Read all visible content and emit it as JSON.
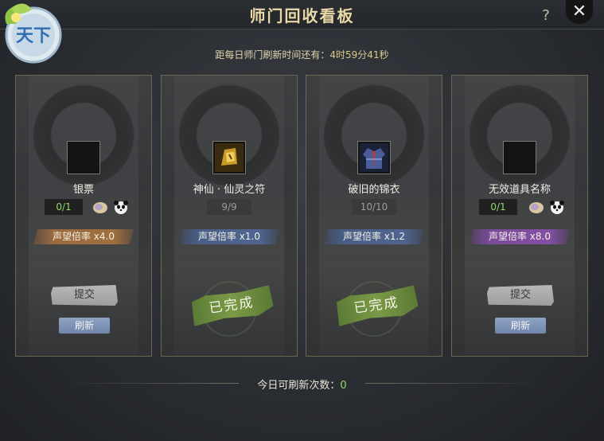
{
  "window": {
    "title": "师门回收看板",
    "help_label": "?",
    "close_label": "✕",
    "logo_text": "天下"
  },
  "timer": {
    "label": "距每日师门刷新时间还有：",
    "value": "4时59分41秒"
  },
  "cards": [
    {
      "item_name": "银票",
      "quantity": "0/1",
      "multiplier": "声望倍率 x4.0",
      "multiplier_color": "brown",
      "submit_label": "提交",
      "refresh_label": "刷新",
      "completed": false,
      "icons": [
        "shell-icon",
        "panda-icon"
      ]
    },
    {
      "item_name": "神仙 · 仙灵之符",
      "quantity": "9/9",
      "multiplier": "声望倍率 x1.0",
      "multiplier_color": "blue",
      "completed": true,
      "stamp_label": "已完成",
      "icon": "talisman-icon"
    },
    {
      "item_name": "破旧的锦衣",
      "quantity": "10/10",
      "multiplier": "声望倍率 x1.2",
      "multiplier_color": "blue",
      "completed": true,
      "stamp_label": "已完成",
      "icon": "robe-icon"
    },
    {
      "item_name": "无效道具名称",
      "quantity": "0/1",
      "multiplier": "声望倍率 x8.0",
      "multiplier_color": "purple",
      "submit_label": "提交",
      "refresh_label": "刷新",
      "completed": false,
      "icons": [
        "shell-icon",
        "panda-icon"
      ]
    }
  ],
  "footer": {
    "label": "今日可刷新次数：",
    "count": "0"
  },
  "colors": {
    "accent_green": "#8fdc6a",
    "title_gold": "#e9d9a6",
    "stamp_green": "#7a9a48"
  }
}
